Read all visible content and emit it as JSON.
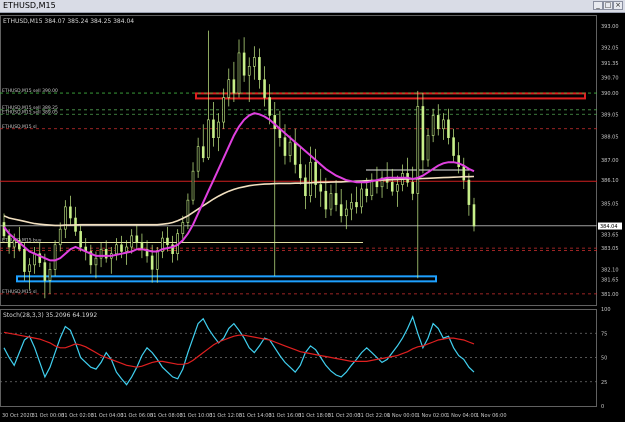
{
  "window": {
    "title": "ETHUSD,M15",
    "buttons": [
      "_",
      "□",
      "×"
    ]
  },
  "chart_data": [
    {
      "type": "candlestick",
      "title": "ETHUSD,M15 384.07 385.24 384.25 384.04",
      "symbol": "ETHUSD",
      "timeframe": "M15",
      "ylim": [
        380.5,
        393.5
      ],
      "ytick_labels": [
        "381.00",
        "381.65",
        "382.10",
        "383.05",
        "383.65",
        "384.05",
        "385.05",
        "386.10",
        "387.00",
        "388.05",
        "389.05",
        "390.00",
        "390.70",
        "391.35",
        "392.05",
        "393.00"
      ],
      "ytick_values": [
        381.0,
        381.65,
        382.1,
        383.05,
        383.65,
        384.05,
        385.05,
        386.1,
        387.0,
        388.05,
        389.05,
        390.0,
        390.7,
        391.35,
        392.05,
        393.0
      ],
      "current_price_label": "384.04",
      "current_price": 384.04,
      "xtick_labels": [
        "30 Oct 2020",
        "31 Oct 00:00",
        "31 Oct 02:00",
        "31 Oct 04:00",
        "31 Oct 06:00",
        "31 Oct 08:00",
        "31 Oct 10:00",
        "31 Oct 12:00",
        "31 Oct 14:00",
        "31 Oct 16:00",
        "31 Oct 18:00",
        "31 Oct 20:00",
        "31 Oct 22:00",
        "1 Nov 00:00",
        "1 Nov 02:00",
        "1 Nov 04:00",
        "1 Nov 06:00"
      ],
      "candle_color": "#c8f08a",
      "candles": [
        [
          384.2,
          384.6,
          383.4,
          383.6
        ],
        [
          383.6,
          383.9,
          382.8,
          383.1
        ],
        [
          383.1,
          383.7,
          382.6,
          383.4
        ],
        [
          383.4,
          384.0,
          382.9,
          383.0
        ],
        [
          383.0,
          383.3,
          381.6,
          382.0
        ],
        [
          382.0,
          382.6,
          381.2,
          382.3
        ],
        [
          382.3,
          383.1,
          381.9,
          382.8
        ],
        [
          382.8,
          383.3,
          382.2,
          382.4
        ],
        [
          382.4,
          382.8,
          380.8,
          381.6
        ],
        [
          381.6,
          382.4,
          381.0,
          382.1
        ],
        [
          382.1,
          383.4,
          381.8,
          383.2
        ],
        [
          383.2,
          384.2,
          382.9,
          383.9
        ],
        [
          383.9,
          385.2,
          383.5,
          384.9
        ],
        [
          384.9,
          385.4,
          384.1,
          384.4
        ],
        [
          384.4,
          384.9,
          383.6,
          383.8
        ],
        [
          383.8,
          384.1,
          382.9,
          383.1
        ],
        [
          383.1,
          383.5,
          382.5,
          382.9
        ],
        [
          382.9,
          383.2,
          381.9,
          382.3
        ],
        [
          382.3,
          382.9,
          381.7,
          382.6
        ],
        [
          382.6,
          383.3,
          382.2,
          383.0
        ],
        [
          383.0,
          383.4,
          382.4,
          382.6
        ],
        [
          382.6,
          383.1,
          381.9,
          382.8
        ],
        [
          382.8,
          383.5,
          382.5,
          383.2
        ],
        [
          383.2,
          383.6,
          382.6,
          382.9
        ],
        [
          382.9,
          383.4,
          382.3,
          383.1
        ],
        [
          383.1,
          383.9,
          382.8,
          383.6
        ],
        [
          383.6,
          384.1,
          383.0,
          383.3
        ],
        [
          383.3,
          383.7,
          382.6,
          383.0
        ],
        [
          383.0,
          383.4,
          382.4,
          382.7
        ],
        [
          382.7,
          383.2,
          381.5,
          382.1
        ],
        [
          382.1,
          383.1,
          381.5,
          382.9
        ],
        [
          382.9,
          383.8,
          382.6,
          383.5
        ],
        [
          383.5,
          384.0,
          382.9,
          383.2
        ],
        [
          383.2,
          383.6,
          382.4,
          382.8
        ],
        [
          382.8,
          383.9,
          382.5,
          383.7
        ],
        [
          383.7,
          384.5,
          383.3,
          384.2
        ],
        [
          384.2,
          385.5,
          383.9,
          385.2
        ],
        [
          385.2,
          386.9,
          385.0,
          386.5
        ],
        [
          386.5,
          388.0,
          386.2,
          387.6
        ],
        [
          387.6,
          388.6,
          386.9,
          387.1
        ],
        [
          387.1,
          392.8,
          387.0,
          388.8
        ],
        [
          388.8,
          389.6,
          387.6,
          388.0
        ],
        [
          388.0,
          389.1,
          387.4,
          388.7
        ],
        [
          388.7,
          390.2,
          388.4,
          389.8
        ],
        [
          389.8,
          391.1,
          389.4,
          390.6
        ],
        [
          390.6,
          391.4,
          389.6,
          390.0
        ],
        [
          390.0,
          392.4,
          389.8,
          391.8
        ],
        [
          391.8,
          392.5,
          390.5,
          390.8
        ],
        [
          390.8,
          391.6,
          389.6,
          391.2
        ],
        [
          391.2,
          392.1,
          390.6,
          391.6
        ],
        [
          391.6,
          392.0,
          390.2,
          390.6
        ],
        [
          390.6,
          391.2,
          389.4,
          389.8
        ],
        [
          389.8,
          390.4,
          388.6,
          389.0
        ],
        [
          389.0,
          389.6,
          381.8,
          388.4
        ],
        [
          388.4,
          389.2,
          387.6,
          388.0
        ],
        [
          388.0,
          388.6,
          386.8,
          387.2
        ],
        [
          387.2,
          388.1,
          386.9,
          387.8
        ],
        [
          387.8,
          388.4,
          386.4,
          386.8
        ],
        [
          386.8,
          387.6,
          385.9,
          386.2
        ],
        [
          386.2,
          386.8,
          384.8,
          385.4
        ],
        [
          385.4,
          387.6,
          385.1,
          386.9
        ],
        [
          386.9,
          387.5,
          385.3,
          385.9
        ],
        [
          385.9,
          386.6,
          384.9,
          385.6
        ],
        [
          385.6,
          386.2,
          384.4,
          384.8
        ],
        [
          384.8,
          385.9,
          384.5,
          385.5
        ],
        [
          385.5,
          386.1,
          384.7,
          385.0
        ],
        [
          385.0,
          385.7,
          384.2,
          384.5
        ],
        [
          384.5,
          385.2,
          383.9,
          384.8
        ],
        [
          384.8,
          385.5,
          384.3,
          385.1
        ],
        [
          385.1,
          385.8,
          384.6,
          384.9
        ],
        [
          384.9,
          386.0,
          384.6,
          385.7
        ],
        [
          385.7,
          386.2,
          385.1,
          385.4
        ],
        [
          385.4,
          386.4,
          385.2,
          386.1
        ],
        [
          386.1,
          386.7,
          385.5,
          385.8
        ],
        [
          385.8,
          386.5,
          385.3,
          386.2
        ],
        [
          386.2,
          386.9,
          385.7,
          386.0
        ],
        [
          386.0,
          386.6,
          385.4,
          385.6
        ],
        [
          385.6,
          386.3,
          384.9,
          385.9
        ],
        [
          385.9,
          386.8,
          385.6,
          386.4
        ],
        [
          386.4,
          387.1,
          385.8,
          386.0
        ],
        [
          386.0,
          386.7,
          385.2,
          385.5
        ],
        [
          385.5,
          390.1,
          381.7,
          389.4
        ],
        [
          389.4,
          390.0,
          386.4,
          387.0
        ],
        [
          387.0,
          388.4,
          386.7,
          388.1
        ],
        [
          388.1,
          389.3,
          387.8,
          389.0
        ],
        [
          389.0,
          389.5,
          388.1,
          388.4
        ],
        [
          388.4,
          389.1,
          387.9,
          388.8
        ],
        [
          388.8,
          389.3,
          387.7,
          388.0
        ],
        [
          388.0,
          388.4,
          386.9,
          387.2
        ],
        [
          387.2,
          387.8,
          386.4,
          386.7
        ],
        [
          386.7,
          387.1,
          385.7,
          386.1
        ],
        [
          386.1,
          386.4,
          384.5,
          385.0
        ],
        [
          385.0,
          385.3,
          383.8,
          384.04
        ]
      ],
      "lines": [
        {
          "name": "ma_slow",
          "color": "#f2e0c0",
          "values": [
            384.5,
            384.4,
            384.35,
            384.3,
            384.25,
            384.2,
            384.15,
            384.12,
            384.1,
            384.08,
            384.07,
            384.07,
            384.08,
            384.08,
            384.09,
            384.1,
            384.1,
            384.1,
            384.1,
            384.1,
            384.1,
            384.1,
            384.1,
            384.1,
            384.1,
            384.1,
            384.1,
            384.1,
            384.1,
            384.1,
            384.1,
            384.12,
            384.15,
            384.2,
            384.28,
            384.38,
            384.5,
            384.65,
            384.8,
            384.95,
            385.1,
            385.25,
            385.38,
            385.5,
            385.6,
            385.68,
            385.75,
            385.8,
            385.85,
            385.88,
            385.9,
            385.92,
            385.93,
            385.94,
            385.95,
            385.95,
            385.95,
            385.96,
            385.96,
            385.97,
            385.98,
            385.99,
            386.0,
            386.0,
            386.01,
            386.02,
            386.02,
            386.03,
            386.04,
            386.05,
            386.06,
            386.07,
            386.08,
            386.09,
            386.1,
            386.11,
            386.12,
            386.13,
            386.14,
            386.15,
            386.15,
            386.16,
            386.17,
            386.18,
            386.19,
            386.2,
            386.21,
            386.22,
            386.23,
            386.24,
            386.25,
            386.25,
            386.26
          ]
        },
        {
          "name": "ma_fast",
          "color": "#e040e0",
          "values": [
            384.0,
            383.7,
            383.5,
            383.3,
            383.1,
            382.9,
            382.8,
            382.7,
            382.6,
            382.5,
            382.5,
            382.6,
            382.8,
            383.0,
            383.1,
            383.0,
            382.9,
            382.8,
            382.7,
            382.7,
            382.7,
            382.7,
            382.75,
            382.8,
            382.85,
            382.9,
            383.0,
            383.0,
            382.95,
            382.9,
            382.9,
            383.0,
            383.05,
            383.1,
            383.2,
            383.4,
            383.7,
            384.1,
            384.6,
            385.1,
            385.6,
            386.1,
            386.6,
            387.1,
            387.6,
            388.1,
            388.5,
            388.8,
            389.0,
            389.1,
            389.05,
            388.95,
            388.8,
            388.6,
            388.4,
            388.2,
            388.0,
            387.8,
            387.6,
            387.4,
            387.2,
            387.0,
            386.8,
            386.6,
            386.45,
            386.3,
            386.2,
            386.1,
            386.05,
            386.0,
            386.0,
            386.0,
            386.05,
            386.1,
            386.15,
            386.2,
            386.2,
            386.2,
            386.2,
            386.2,
            386.15,
            386.2,
            386.3,
            386.45,
            386.6,
            386.75,
            386.85,
            386.9,
            386.9,
            386.85,
            386.75,
            386.6,
            386.5
          ]
        }
      ],
      "hlines": [
        {
          "value": 389.85,
          "color": "#e02020",
          "style": "band"
        },
        {
          "value": 386.55,
          "color": "#e8e8e8",
          "style": "solid"
        },
        {
          "value": 386.05,
          "color": "#d02020",
          "style": "solid"
        },
        {
          "value": 384.05,
          "color": "#a0a0a0",
          "style": "solid"
        },
        {
          "value": 383.3,
          "color": "#e0e0a0",
          "style": "solid"
        },
        {
          "value": 381.65,
          "color": "#1ea0ff",
          "style": "band"
        },
        {
          "value": 390.0,
          "color": "#40b040",
          "style": "dash"
        },
        {
          "value": 389.25,
          "color": "#50a050",
          "style": "dash"
        },
        {
          "value": 389.05,
          "color": "#50a050",
          "style": "dash"
        },
        {
          "value": 388.4,
          "color": "#d03030",
          "style": "dash"
        },
        {
          "value": 383.05,
          "color": "#d03030",
          "style": "dash"
        },
        {
          "value": 382.95,
          "color": "#d03030",
          "style": "dash"
        },
        {
          "value": 381.0,
          "color": "#d03030",
          "style": "dash"
        }
      ],
      "left_labels": [
        {
          "text": "ETHUSD,M15  sell 390.00",
          "value": 390.0
        },
        {
          "text": "ETHUSD,M15  sell 389.25",
          "value": 389.25
        },
        {
          "text": "ETHUSD,M15  sell 389.05",
          "value": 389.05
        },
        {
          "text": "ETHUSD,M15  sl",
          "value": 388.4
        },
        {
          "text": "ETHUSD,M15  buy",
          "value": 383.3
        },
        {
          "text": "ETHUSD,M15  sl",
          "value": 381.0
        }
      ]
    },
    {
      "type": "line",
      "title": "Stoch(28,3,3) 35.2096 64.1992",
      "ylim": [
        0,
        100
      ],
      "ytick_labels": [
        "100",
        "75",
        "50",
        "25",
        "0"
      ],
      "ytick_values": [
        100,
        75,
        50,
        25,
        0
      ],
      "levels": [
        75,
        50,
        25
      ],
      "series": [
        {
          "color": "#40d0f0",
          "values": [
            60,
            50,
            42,
            55,
            68,
            72,
            60,
            45,
            30,
            40,
            55,
            70,
            82,
            78,
            65,
            50,
            45,
            40,
            38,
            45,
            55,
            48,
            35,
            28,
            22,
            30,
            40,
            52,
            60,
            55,
            48,
            40,
            35,
            30,
            28,
            38,
            55,
            70,
            85,
            90,
            80,
            72,
            65,
            70,
            80,
            85,
            78,
            70,
            60,
            55,
            62,
            70,
            68,
            60,
            52,
            45,
            40,
            35,
            42,
            55,
            62,
            58,
            50,
            42,
            36,
            32,
            30,
            35,
            42,
            48,
            55,
            60,
            55,
            50,
            45,
            48,
            55,
            62,
            70,
            80,
            92,
            75,
            60,
            70,
            85,
            80,
            70,
            72,
            60,
            52,
            48,
            40,
            35
          ]
        },
        {
          "color": "#e02020",
          "values": [
            76,
            75,
            74,
            73,
            72,
            71,
            70,
            69,
            67,
            65,
            62,
            60,
            60,
            62,
            64,
            63,
            61,
            58,
            55,
            52,
            50,
            48,
            46,
            44,
            42,
            41,
            40,
            41,
            43,
            45,
            46,
            46,
            45,
            44,
            43,
            43,
            44,
            47,
            51,
            55,
            59,
            63,
            66,
            68,
            70,
            72,
            73,
            73,
            72,
            71,
            70,
            69,
            68,
            66,
            64,
            62,
            60,
            58,
            56,
            55,
            54,
            53,
            52,
            51,
            50,
            49,
            48,
            47,
            46,
            46,
            46,
            46,
            47,
            48,
            49,
            50,
            51,
            52,
            54,
            56,
            59,
            61,
            62,
            64,
            66,
            68,
            69,
            70,
            70,
            69,
            68,
            66,
            64
          ]
        }
      ]
    }
  ]
}
